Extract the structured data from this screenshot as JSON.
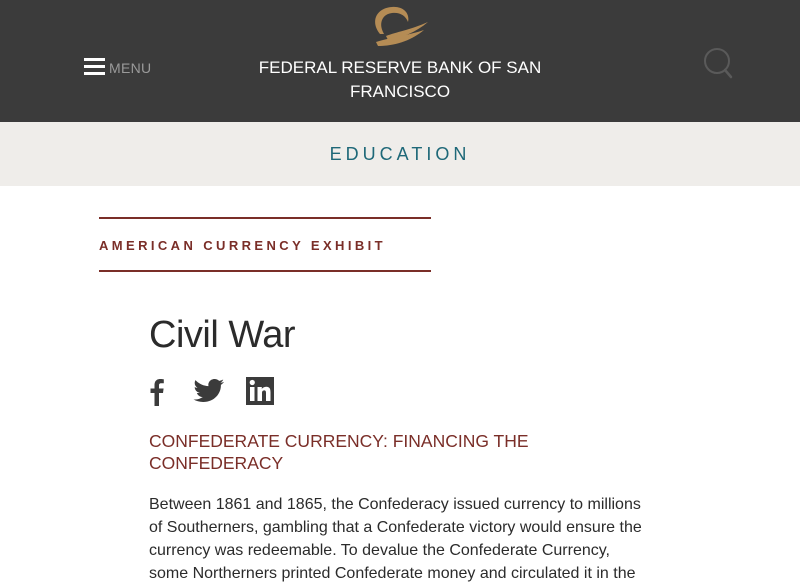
{
  "header": {
    "site_title": "FEDERAL RESERVE BANK OF SAN FRANCISCO",
    "menu_label": "MENU",
    "icons": {
      "logo": "eagle-logo-icon",
      "menu": "hamburger-icon",
      "search": "search-icon"
    }
  },
  "section": {
    "label": "EDUCATION"
  },
  "exhibit": {
    "label": "AMERICAN CURRENCY EXHIBIT"
  },
  "article": {
    "title": "Civil War",
    "share_icons": [
      "facebook-icon",
      "twitter-icon",
      "linkedin-icon"
    ],
    "subheading": "CONFEDERATE CURRENCY: FINANCING THE CONFEDERACY",
    "paragraph": "Between 1861 and 1865, the Confederacy issued currency to millions of Southerners, gambling that a Confederate victory would ensure the currency was redeemable. To devalue the Confederate Currency, some Northerners printed Confederate money and circulated it in the"
  },
  "colors": {
    "header_bg": "#3b3b3b",
    "band_bg": "#efedea",
    "section_label": "#1e6878",
    "accent_maroon": "#7a2e28",
    "logo_gold": "#b58c55",
    "body_text": "#2b2b2b"
  }
}
